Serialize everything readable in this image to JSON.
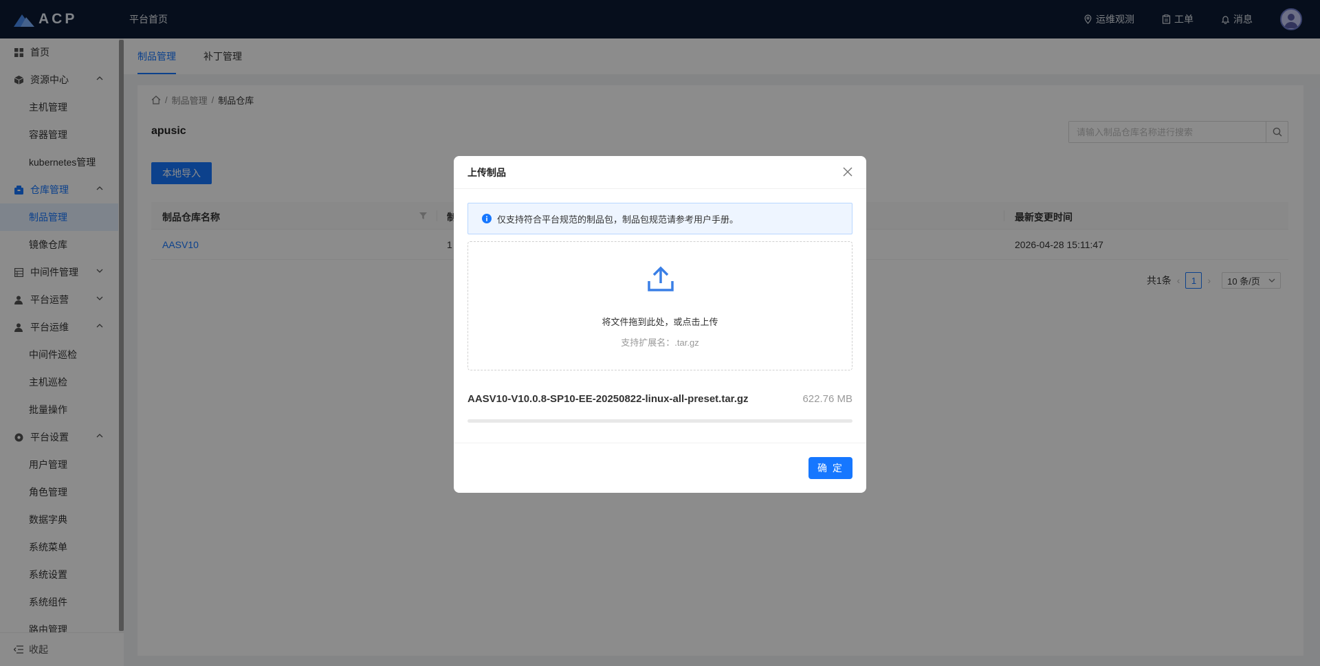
{
  "header": {
    "logo_text": "ACP",
    "home_link": "平台首页",
    "nav": [
      {
        "label": "运维观测",
        "icon": "location-icon"
      },
      {
        "label": "工单",
        "icon": "clipboard-icon"
      },
      {
        "label": "消息",
        "icon": "bell-icon"
      }
    ]
  },
  "sidebar": {
    "items": [
      {
        "label": "首页",
        "icon": "grid-icon"
      },
      {
        "label": "资源中心",
        "icon": "cube-icon"
      },
      {
        "label": "主机管理"
      },
      {
        "label": "容器管理"
      },
      {
        "label": "kubernetes管理"
      },
      {
        "label": "仓库管理",
        "icon": "package-icon"
      },
      {
        "label": "制品管理"
      },
      {
        "label": "镜像仓库"
      },
      {
        "label": "中间件管理",
        "icon": "server-icon"
      },
      {
        "label": "平台运营",
        "icon": "user-icon"
      },
      {
        "label": "平台运维",
        "icon": "user-icon"
      },
      {
        "label": "中间件巡检"
      },
      {
        "label": "主机巡检"
      },
      {
        "label": "批量操作"
      },
      {
        "label": "平台设置",
        "icon": "gear-icon"
      },
      {
        "label": "用户管理"
      },
      {
        "label": "角色管理"
      },
      {
        "label": "数据字典"
      },
      {
        "label": "系统菜单"
      },
      {
        "label": "系统设置"
      },
      {
        "label": "系统组件"
      },
      {
        "label": "路由管理"
      }
    ],
    "collapse_label": "收起"
  },
  "tabs": [
    {
      "label": "制品管理"
    },
    {
      "label": "补丁管理"
    }
  ],
  "breadcrumb": {
    "level1": "制品管理",
    "level2": "制品仓库"
  },
  "page": {
    "title": "apusic",
    "search_placeholder": "请输入制品仓库名称进行搜索",
    "import_button": "本地导入"
  },
  "table": {
    "columns": [
      "制品仓库名称",
      "制",
      "最新变更时间"
    ],
    "rows": [
      {
        "name": "AASV10",
        "count": "1",
        "updated": "2026-04-28 15:11:47"
      }
    ]
  },
  "pagination": {
    "total": "共1条",
    "current": "1",
    "page_size": "10 条/页"
  },
  "modal": {
    "title": "上传制品",
    "notice": "仅支持符合平台规范的制品包，制品包规范请参考用户手册。",
    "drop_text": "将文件拖到此处，或点击上传",
    "drop_hint": "支持扩展名：.tar.gz",
    "file_name": "AASV10-V10.0.8-SP10-EE-20250822-linux-all-preset.tar.gz",
    "file_size": "622.76 MB",
    "confirm_button": "确 定"
  },
  "colors": {
    "primary": "#1677ff",
    "header_bg": "#0b1a33"
  }
}
